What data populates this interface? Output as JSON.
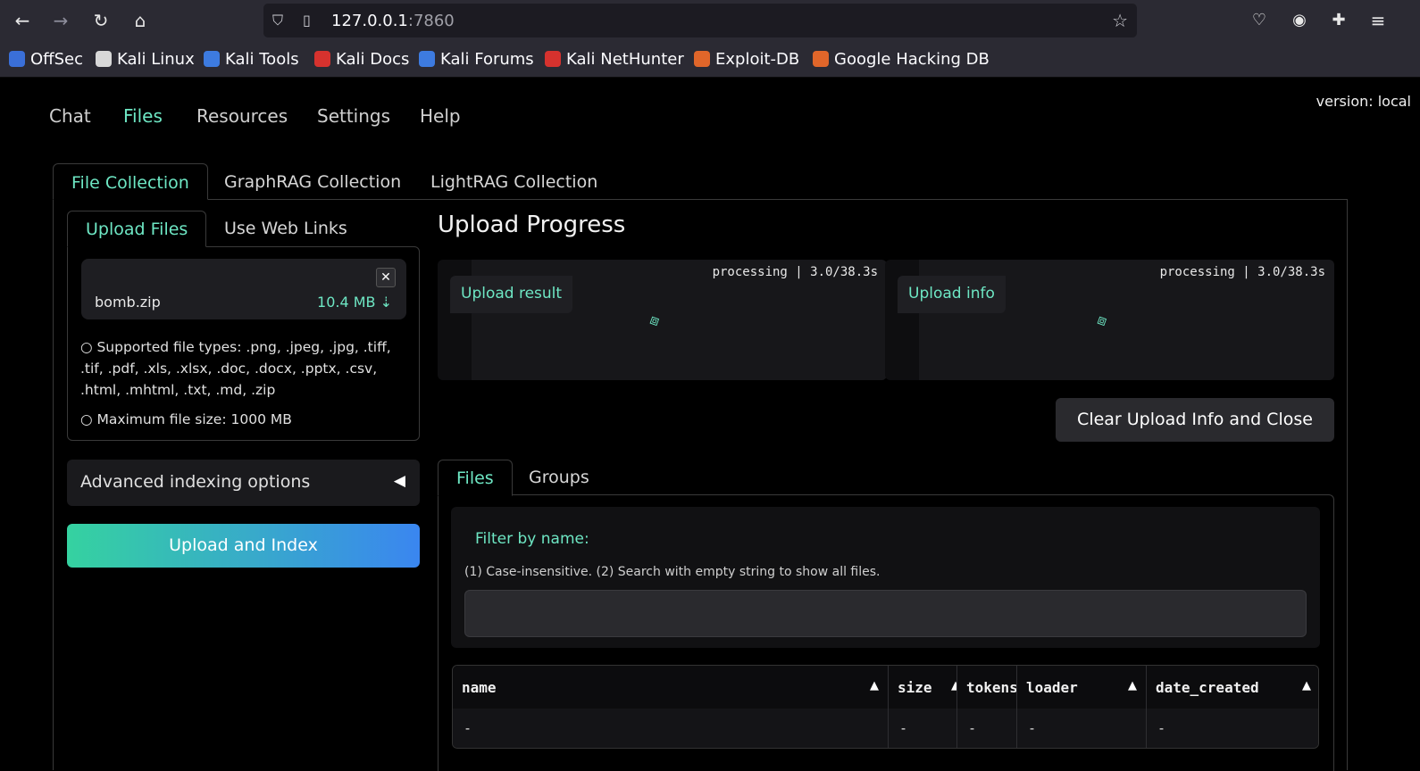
{
  "browser": {
    "url_host": "127.0.0.1",
    "url_port": ":7860",
    "bookmarks": [
      {
        "label": "OffSec",
        "color": "#3a6fd8"
      },
      {
        "label": "Kali Linux",
        "color": "#d8d8d8"
      },
      {
        "label": "Kali Tools",
        "color": "#3d7be0"
      },
      {
        "label": "Kali Docs",
        "color": "#d6322e"
      },
      {
        "label": "Kali Forums",
        "color": "#3d7be0"
      },
      {
        "label": "Kali NetHunter",
        "color": "#d6322e"
      },
      {
        "label": "Exploit-DB",
        "color": "#e0662a"
      },
      {
        "label": "Google Hacking DB",
        "color": "#e0662a"
      }
    ]
  },
  "app": {
    "version": "version: local",
    "nav": [
      "Chat",
      "Files",
      "Resources",
      "Settings",
      "Help"
    ],
    "active_nav": "Files",
    "collection_tabs": [
      "File Collection",
      "GraphRAG Collection",
      "LightRAG Collection"
    ],
    "upload_tabs": [
      "Upload Files",
      "Use Web Links"
    ],
    "file": {
      "name": "bomb.zip",
      "size": "10.4 MB ⇣"
    },
    "info_types": "○ Supported file types: .png, .jpeg, .jpg, .tiff, .tif, .pdf, .xls, .xlsx, .doc, .docx, .pptx, .csv, .html, .mhtml, .txt, .md, .zip",
    "info_size": "○ Maximum file size: 1000 MB",
    "advanced_label": "Advanced indexing options",
    "upload_button": "Upload and Index",
    "progress_title": "Upload Progress",
    "progress_panels": [
      {
        "label": "Upload result",
        "status": "processing | 3.0/38.3s"
      },
      {
        "label": "Upload info",
        "status": "processing | 3.0/38.3s"
      }
    ],
    "clear_button": "Clear Upload Info and Close",
    "files_tabs": [
      "Files",
      "Groups"
    ],
    "filter_title": "Filter by name:",
    "filter_hint": "(1) Case-insensitive. (2) Search with empty string to show all files.",
    "table": {
      "columns": [
        "name",
        "size",
        "tokens",
        "loader",
        "date_created"
      ],
      "rows": [
        [
          "-",
          "-",
          "-",
          "-",
          "-"
        ]
      ]
    }
  },
  "colors": {
    "accent": "#6ee7c4",
    "gradient_start": "#35d2a0",
    "gradient_end": "#3a86f0"
  }
}
